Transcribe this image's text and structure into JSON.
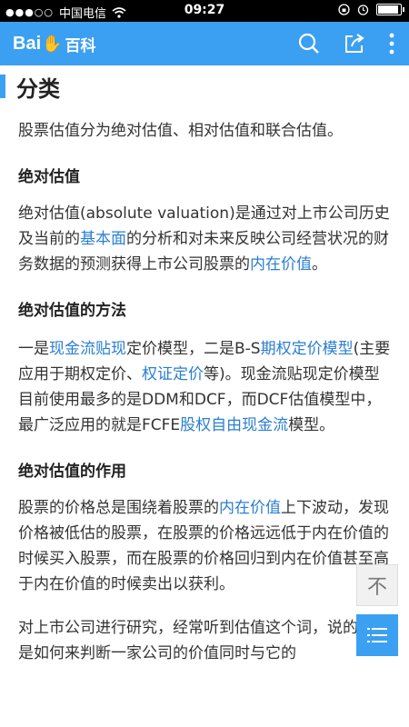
{
  "status": {
    "carrier": "中国电信",
    "time": "09:27"
  },
  "header": {
    "logo_a": "Bai",
    "logo_b": "du",
    "logo_zh": "百科"
  },
  "section": {
    "title": "分类",
    "intro": "股票估值分为绝对估值、相对估值和联合估值。"
  },
  "abs": {
    "heading": "绝对估值",
    "t1": "绝对估值(absolute valuation)是通过对上市公司历史及当前的",
    "l1": "基本面",
    "t2": "的分析和对未来反映公司经营状况的财务数据的预测获得上市公司股票的",
    "l2": "内在价值",
    "t3": "。"
  },
  "method": {
    "heading": "绝对估值的方法",
    "t1": "一是",
    "l1": "现金流贴现",
    "t2": "定价模型，二是B-S",
    "l2": "期权定价模型",
    "t3": "(主要应用于期权定价、",
    "l3": "权证定价",
    "t4": "等)。现金流贴现定价模型目前使用最多的是DDM和DCF，而DCF估值模型中，最广泛应用的就是FCFE",
    "l4": "股权自由现金流",
    "t5": "模型。"
  },
  "role": {
    "heading": "绝对估值的作用",
    "t1": "股票的价格总是围绕着股票的",
    "l1": "内在价值",
    "t2": "上下波动，发现价格被低估的股票，在股票的价格远远低于内在价值的时候买入股票，而在股票的价格回归到内在价值甚至高于内在价值的时候卖出以获利。"
  },
  "last": {
    "text": "对上市公司进行研究，经常听到估值这个词，说的其实是如何来判断一家公司的价值同时与它的"
  },
  "float": {
    "top_label": "不"
  }
}
